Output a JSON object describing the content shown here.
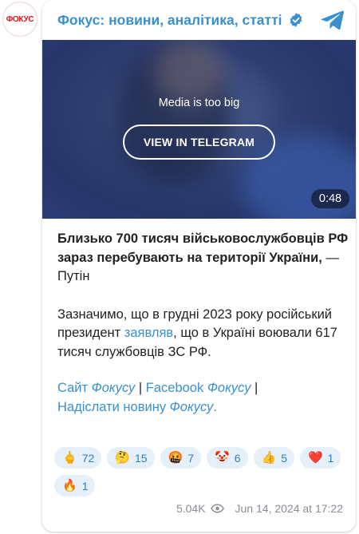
{
  "channel": {
    "avatar_text": "ФОКУС",
    "name": "Фокус: новини, аналітика, статті",
    "verified": true
  },
  "media": {
    "message": "Media is too big",
    "button_label": "VIEW IN TELEGRAM",
    "duration": "0:48"
  },
  "post": {
    "headline_bold": "Близько 700 тисяч військовослужбовців РФ зараз перебувають на території України,",
    "headline_rest": " — Путін",
    "body_before": "Зазначимо, що в грудні 2023 року російський президент ",
    "body_link": "заявляв",
    "body_after": ", що в Україні воювали 617 тисяч службовців ЗС РФ.",
    "links": {
      "site_word": "Сайт ",
      "site_italic": "Фокусу",
      "sep1": " | ",
      "fb_word": "Facebook ",
      "fb_italic": "Фокусу",
      "sep2": " |",
      "send_word": "Надіслати новину ",
      "send_italic": "Фокусу",
      "send_end": "."
    }
  },
  "reactions": [
    {
      "icon": "middle-finger-emoji",
      "emoji": "🖕",
      "count": "72"
    },
    {
      "icon": "thinking-emoji",
      "emoji": "🤔",
      "count": "15"
    },
    {
      "icon": "cursing-face-emoji",
      "emoji": "🤬",
      "count": "7"
    },
    {
      "icon": "clown-emoji",
      "emoji": "🤡",
      "count": "6"
    },
    {
      "icon": "thumbs-up-emoji",
      "emoji": "👍",
      "count": "5"
    },
    {
      "icon": "red-heart-emoji",
      "emoji": "❤️",
      "count": "1"
    },
    {
      "icon": "fire-emoji",
      "emoji": "🔥",
      "count": "1"
    }
  ],
  "footer": {
    "views": "5.04K",
    "timestamp": "Jun 14, 2024 at 17:22"
  },
  "colors": {
    "accent": "#3a8fd0",
    "brand_red": "#e3121b",
    "reaction_bg": "#e5f0fa"
  }
}
